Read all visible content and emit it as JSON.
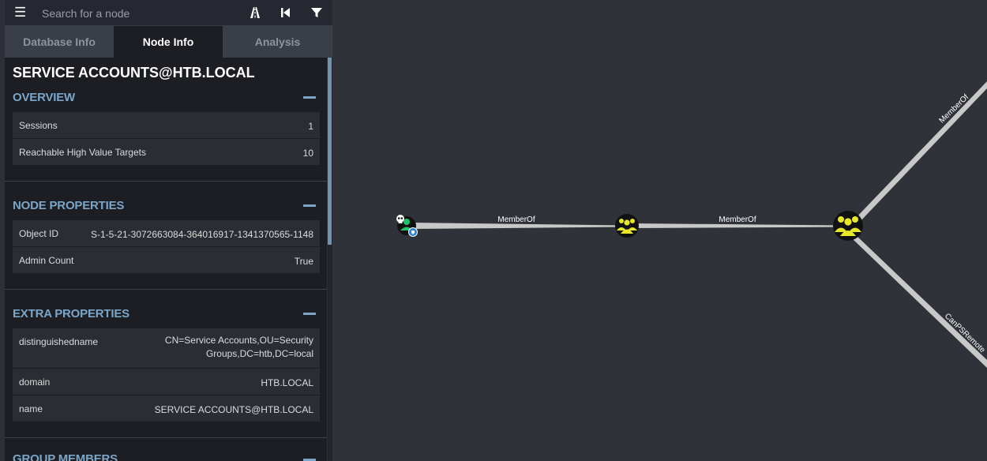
{
  "search": {
    "placeholder": "Search for a node"
  },
  "tabs": [
    {
      "label": "Database Info"
    },
    {
      "label": "Node Info"
    },
    {
      "label": "Analysis"
    }
  ],
  "node": {
    "title": "SERVICE ACCOUNTS@HTB.LOCAL",
    "overview": {
      "heading": "OVERVIEW",
      "rows": [
        {
          "key": "Sessions",
          "value": "1"
        },
        {
          "key": "Reachable High Value Targets",
          "value": "10"
        }
      ]
    },
    "node_properties": {
      "heading": "NODE PROPERTIES",
      "rows": [
        {
          "key": "Object ID",
          "value": "S-1-5-21-3072663084-364016917-1341370565-1148"
        },
        {
          "key": "Admin Count",
          "value": "True"
        }
      ]
    },
    "extra_properties": {
      "heading": "EXTRA PROPERTIES",
      "rows": [
        {
          "key": "distinguishedname",
          "value_line1": "CN=Service Accounts,OU=Security",
          "value_line2": "Groups,DC=htb,DC=local"
        },
        {
          "key": "domain",
          "value": "HTB.LOCAL"
        },
        {
          "key": "name",
          "value": "SERVICE ACCOUNTS@HTB.LOCAL"
        }
      ]
    },
    "group_members": {
      "heading": "GROUP MEMBERS"
    }
  },
  "graph": {
    "edges": [
      {
        "label": "MemberOf"
      },
      {
        "label": "MemberOf"
      },
      {
        "label": "MemberOf"
      },
      {
        "label": "CanPSRemote"
      }
    ],
    "colors": {
      "background": "#2f3238",
      "edge": "#c8c8c8",
      "group_node": "#e8e82a",
      "user_node": "#1fc26a"
    }
  }
}
